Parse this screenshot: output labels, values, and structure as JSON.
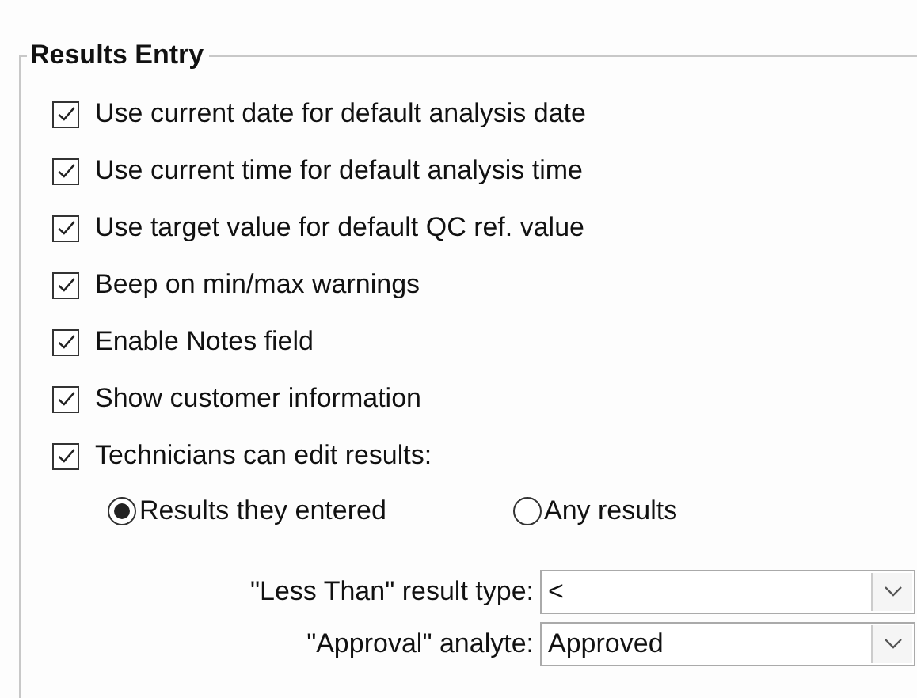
{
  "group": {
    "title": "Results Entry"
  },
  "options": [
    {
      "label": "Use current date for default analysis date",
      "checked": true
    },
    {
      "label": "Use current time for default analysis time",
      "checked": true
    },
    {
      "label": "Use target value for default QC ref. value",
      "checked": true
    },
    {
      "label": "Beep on min/max warnings",
      "checked": true
    },
    {
      "label": "Enable Notes field",
      "checked": true
    },
    {
      "label": "Show customer information",
      "checked": true
    },
    {
      "label": "Technicians can edit results:",
      "checked": true
    }
  ],
  "edit_scope": [
    {
      "label": "Results they entered",
      "selected": true
    },
    {
      "label": "Any results",
      "selected": false
    }
  ],
  "dropdowns": [
    {
      "label": "\"Less Than\" result type:",
      "value": "<"
    },
    {
      "label": "\"Approval\" analyte:",
      "value": "Approved"
    }
  ]
}
